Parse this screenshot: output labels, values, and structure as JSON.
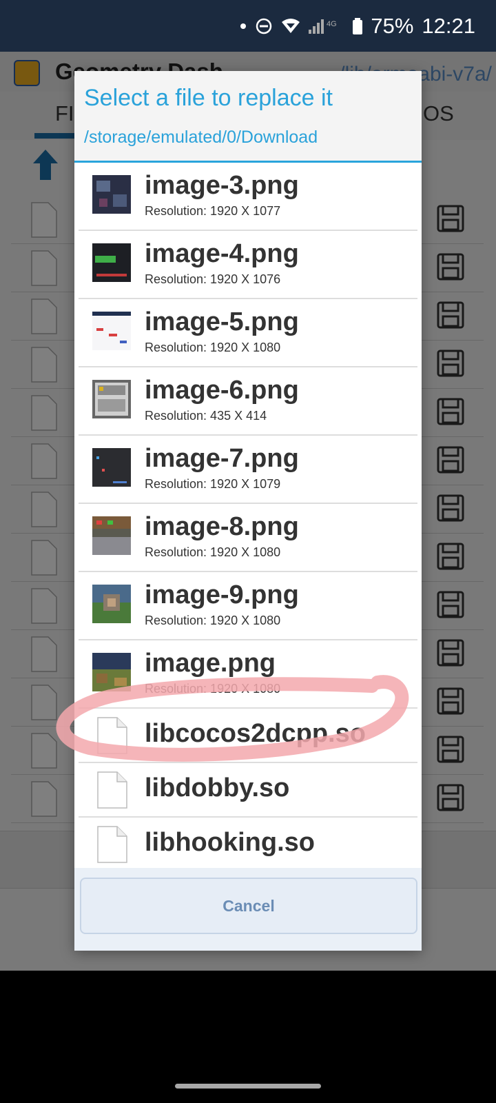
{
  "status_bar": {
    "battery": "75%",
    "time": "12:21",
    "network": "4G"
  },
  "background_app": {
    "title": "Geometry Dash",
    "path": "/lib/armeabi-v7a/",
    "tab_left": "FI",
    "tab_right": "OS"
  },
  "dialog": {
    "title": "Select a file to replace it",
    "path": "/storage/emulated/0/Download",
    "items": [
      {
        "name": "image-3.png",
        "resolution": "Resolution: 1920 X 1077",
        "thumb": "image-thumbnail"
      },
      {
        "name": "image-4.png",
        "resolution": "Resolution: 1920 X 1076",
        "thumb": "image-thumbnail"
      },
      {
        "name": "image-5.png",
        "resolution": "Resolution: 1920 X 1080",
        "thumb": "image-thumbnail"
      },
      {
        "name": "image-6.png",
        "resolution": "Resolution: 435 X 414",
        "thumb": "image-thumbnail"
      },
      {
        "name": "image-7.png",
        "resolution": "Resolution: 1920 X 1079",
        "thumb": "image-thumbnail"
      },
      {
        "name": "image-8.png",
        "resolution": "Resolution: 1920 X 1080",
        "thumb": "image-thumbnail"
      },
      {
        "name": "image-9.png",
        "resolution": "Resolution: 1920 X 1080",
        "thumb": "image-thumbnail"
      },
      {
        "name": "image.png",
        "resolution": "Resolution: 1920 X 1080",
        "thumb": "image-thumbnail"
      },
      {
        "name": "libcocos2dcpp.so",
        "icon": "file-icon"
      },
      {
        "name": "libdobby.so",
        "icon": "file-icon"
      },
      {
        "name": "libhooking.so",
        "icon": "file-icon"
      }
    ],
    "cancel_label": "Cancel"
  },
  "colors": {
    "accent": "#2aa2da",
    "highlight": "#f3a8ad",
    "statusbar": "#1b2a3f"
  }
}
